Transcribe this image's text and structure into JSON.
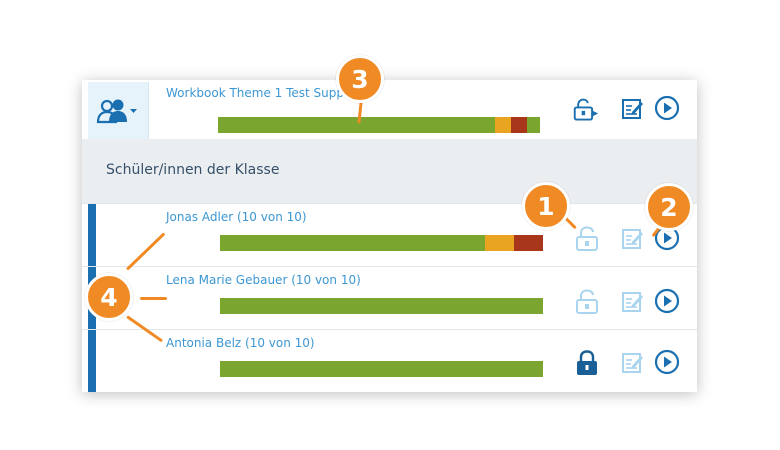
{
  "header": {
    "group_icon": "users-dropdown-icon",
    "workbook_title": "Workbook Theme 1 Test Supp",
    "progress": {
      "green": 0.86,
      "orange": 0.05,
      "red": 0.05
    },
    "actions": [
      "unlock-export-icon",
      "edit-icon",
      "play-icon"
    ]
  },
  "section": {
    "title": "Schüler/innen der Klasse"
  },
  "students": [
    {
      "name": "Jonas Adler (10 von 10)",
      "progress": {
        "green": 0.82,
        "orange": 0.09,
        "red": 0.09
      },
      "lock_icon": "unlock-icon",
      "lock_state": "unlocked"
    },
    {
      "name": "Lena Marie Gebauer (10 von 10)",
      "progress": {
        "green": 1.0,
        "orange": 0,
        "red": 0
      },
      "lock_icon": "unlock-icon",
      "lock_state": "unlocked"
    },
    {
      "name": "Antonia Belz (10 von 10)",
      "progress": {
        "green": 1.0,
        "orange": 0,
        "red": 0
      },
      "lock_icon": "lock-icon",
      "lock_state": "locked"
    }
  ],
  "colors": {
    "green": "#7aa52e",
    "orange": "#eaa520",
    "red": "#a8361a",
    "accent": "#1a6fb0",
    "link": "#3d97d3",
    "callout": "#f08a24",
    "icon_faded": "#a9d4ee"
  },
  "callouts": [
    "1",
    "2",
    "3",
    "4"
  ]
}
